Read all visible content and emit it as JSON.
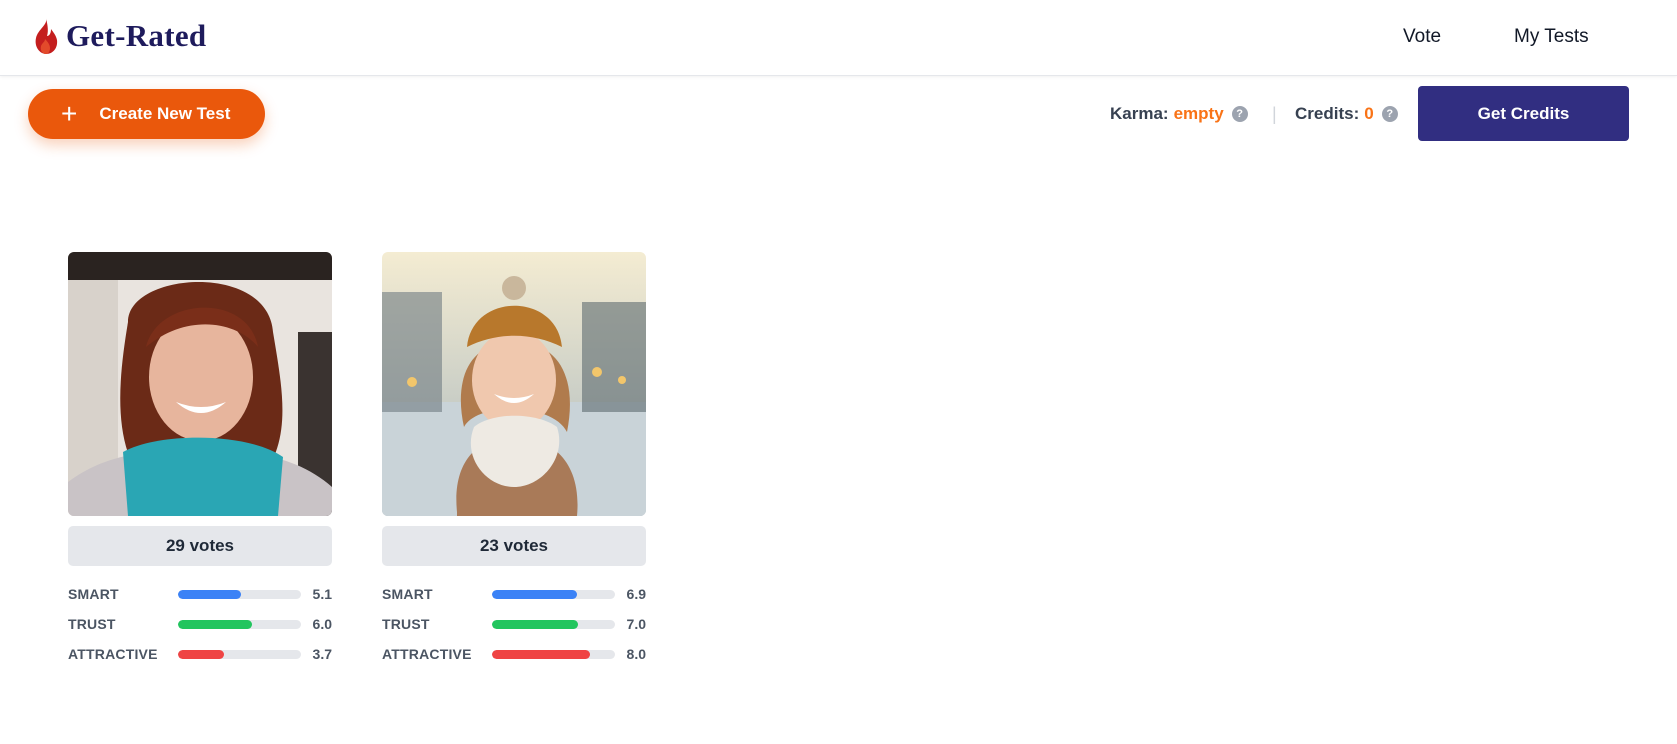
{
  "header": {
    "logo_text": "Get-Rated",
    "nav": {
      "vote": "Vote",
      "my_tests": "My Tests"
    }
  },
  "toolbar": {
    "create_label": "Create New Test",
    "karma_label": "Karma:",
    "karma_value": "empty",
    "credits_label": "Credits:",
    "credits_value": "0",
    "get_credits_label": "Get Credits"
  },
  "colors": {
    "brand_orange": "#ea580c",
    "brand_indigo": "#312e81",
    "smart": "#3b82f6",
    "trust": "#22c55e",
    "attractive": "#ef4444"
  },
  "tests": [
    {
      "votes": "29 votes",
      "metrics": [
        {
          "label": "SMART",
          "value": "5.1",
          "score": 5.1
        },
        {
          "label": "TRUST",
          "value": "6.0",
          "score": 6.0
        },
        {
          "label": "ATTRACTIVE",
          "value": "3.7",
          "score": 3.7
        }
      ]
    },
    {
      "votes": "23 votes",
      "metrics": [
        {
          "label": "SMART",
          "value": "6.9",
          "score": 6.9
        },
        {
          "label": "TRUST",
          "value": "7.0",
          "score": 7.0
        },
        {
          "label": "ATTRACTIVE",
          "value": "8.0",
          "score": 8.0
        }
      ]
    }
  ]
}
